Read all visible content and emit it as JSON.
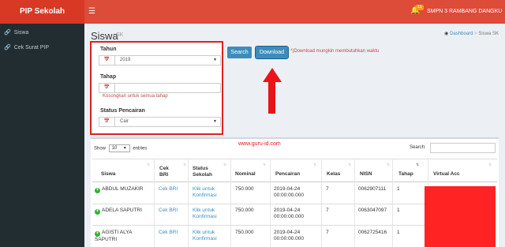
{
  "app": {
    "brand": "PIP Sekolah",
    "menu_icon": "hamburger-icon",
    "notification_count": "15",
    "school_name": "SMPN 3 RAMBANG DANGKU"
  },
  "sidebar": {
    "items": [
      {
        "label": "Siswa",
        "icon": "link-icon"
      },
      {
        "label": "Cek Surat PIP",
        "icon": "link-icon"
      }
    ]
  },
  "header": {
    "title": "Siswa",
    "subtitle": "SK",
    "breadcrumb": [
      "Dashboard",
      "Siswa SK"
    ]
  },
  "filters": {
    "tahun_label": "Tahun",
    "tahun_value": "2019",
    "tahap_label": "Tahap",
    "tahap_value": "",
    "tahap_help": "Kosongkan untuk semua tahap",
    "status_label": "Status Pencairan",
    "status_value": "Cair",
    "search_button": "Search",
    "download_button": "Download",
    "download_note": "*)Download mungkin membutuhkan waktu"
  },
  "annotation": {
    "watermark": "www.guru-id.com"
  },
  "table": {
    "show_label": "Show",
    "page_size": "10",
    "entries_label": "entries",
    "search_label": "Search:",
    "columns": [
      "Siswa",
      "Cek BRI",
      "Status Sekolah",
      "Nominal",
      "Pencairan",
      "Kelas",
      "NISN",
      "Tahap",
      "Virtual Acc"
    ],
    "rows": [
      {
        "siswa": "ABDUL MUZAKIR",
        "cek": "Cek BRI",
        "status": "Klik untuk Konfirmasi",
        "nominal": "750.000",
        "pencairan": "2019-04-24 00:00:00.000",
        "kelas": "7",
        "nisn": "0062907111",
        "tahap": "1"
      },
      {
        "siswa": "ADELA SAPUTRI",
        "cek": "Cek BRI",
        "status": "Klik untuk Konfirmasi",
        "nominal": "750.000",
        "pencairan": "2019-04-24 00:00:00.000",
        "kelas": "7",
        "nisn": "0063047097",
        "tahap": "1"
      },
      {
        "siswa": "AGISTI ALYA SAPUTRI",
        "cek": "Cek BRI",
        "status": "Klik untuk Konfirmasi",
        "nominal": "750.000",
        "pencairan": "2019-04-24 00:00:00.000",
        "kelas": "7",
        "nisn": "0062725416",
        "tahap": "1"
      }
    ]
  },
  "colors": {
    "topbar": "#dd4b39",
    "sidebar": "#222d32",
    "primary": "#3c8dbc",
    "highlight": "#e8141a"
  }
}
